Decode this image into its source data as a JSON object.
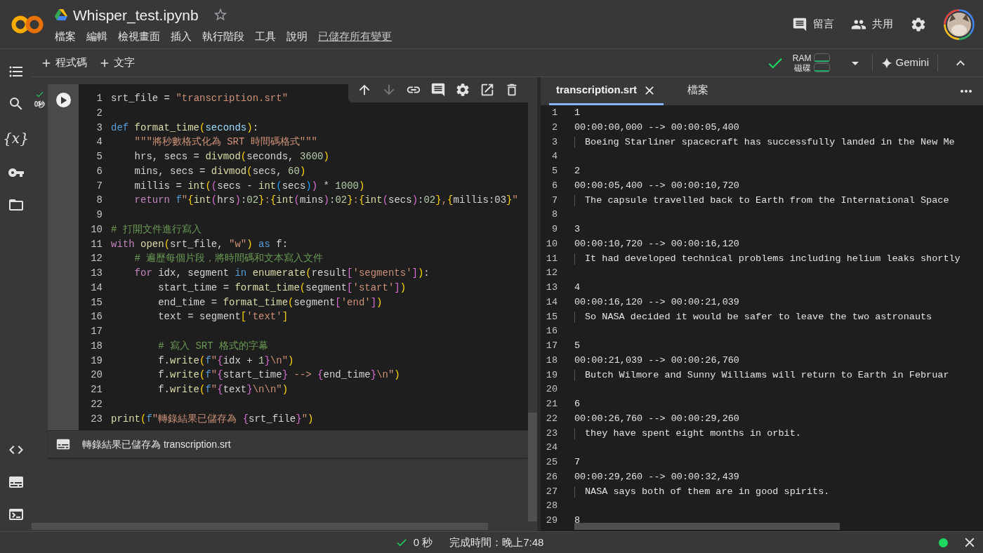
{
  "header": {
    "title": "Whisper_test.ipynb",
    "starred": false,
    "menu": [
      "檔案",
      "編輯",
      "檢視畫面",
      "插入",
      "執行階段",
      "工具",
      "說明"
    ],
    "save_status": "已儲存所有變更",
    "comment": "留言",
    "share": "共用"
  },
  "toolbar": {
    "add_code": "程式碼",
    "add_text": "文字",
    "connected": true,
    "ram_label": "RAM",
    "disk_label": "磁碟",
    "gemini": "Gemini"
  },
  "sidebar": {
    "variables_label": "{x}"
  },
  "cell": {
    "status": "0秒",
    "succeeded": true,
    "lines": [
      {
        "n": "1",
        "tokens": [
          {
            "kind": "plain",
            "t": "srt_file = "
          },
          {
            "kind": "str",
            "t": "\"transcription.srt\""
          }
        ]
      },
      {
        "n": "2"
      },
      {
        "n": "3",
        "tokens": [
          {
            "kind": "kw",
            "t": "def "
          },
          {
            "kind": "fn",
            "t": "format_time"
          },
          {
            "kind": "b1",
            "t": "("
          },
          {
            "kind": "var",
            "t": "seconds"
          },
          {
            "kind": "b1",
            "t": ")"
          },
          {
            "kind": "plain",
            "t": ":"
          }
        ]
      },
      {
        "n": "4",
        "tokens": [
          {
            "kind": "str",
            "t": "    \"\"\"將秒數格式化為 SRT 時間碼格式\"\"\""
          }
        ]
      },
      {
        "n": "5",
        "tokens": [
          {
            "kind": "plain",
            "t": "    hrs, secs = "
          },
          {
            "kind": "fn",
            "t": "divmod"
          },
          {
            "kind": "b1",
            "t": "("
          },
          {
            "kind": "plain",
            "t": "seconds, "
          },
          {
            "kind": "num",
            "t": "3600"
          },
          {
            "kind": "b1",
            "t": ")"
          }
        ]
      },
      {
        "n": "6",
        "tokens": [
          {
            "kind": "plain",
            "t": "    mins, secs = "
          },
          {
            "kind": "fn",
            "t": "divmod"
          },
          {
            "kind": "b1",
            "t": "("
          },
          {
            "kind": "plain",
            "t": "secs, "
          },
          {
            "kind": "num",
            "t": "60"
          },
          {
            "kind": "b1",
            "t": ")"
          }
        ]
      },
      {
        "n": "7",
        "tokens": [
          {
            "kind": "plain",
            "t": "    millis = "
          },
          {
            "kind": "fn",
            "t": "int"
          },
          {
            "kind": "b1",
            "t": "("
          },
          {
            "kind": "b2",
            "t": "("
          },
          {
            "kind": "plain",
            "t": "secs - "
          },
          {
            "kind": "fn",
            "t": "int"
          },
          {
            "kind": "b3",
            "t": "("
          },
          {
            "kind": "plain",
            "t": "secs"
          },
          {
            "kind": "b3",
            "t": ")"
          },
          {
            "kind": "b2",
            "t": ")"
          },
          {
            "kind": "plain",
            "t": " * "
          },
          {
            "kind": "num",
            "t": "1000"
          },
          {
            "kind": "b1",
            "t": ")"
          }
        ]
      },
      {
        "n": "8",
        "tokens": [
          {
            "kind": "kw2",
            "t": "    return "
          },
          {
            "kind": "kw",
            "t": "f"
          },
          {
            "kind": "str",
            "t": "\""
          },
          {
            "kind": "b1",
            "t": "{"
          },
          {
            "kind": "fn",
            "t": "int"
          },
          {
            "kind": "b2",
            "t": "("
          },
          {
            "kind": "plain",
            "t": "hrs"
          },
          {
            "kind": "b2",
            "t": ")"
          },
          {
            "kind": "plain",
            "t": ":"
          },
          {
            "kind": "num",
            "t": "02"
          },
          {
            "kind": "b1",
            "t": "}"
          },
          {
            "kind": "str",
            "t": ":"
          },
          {
            "kind": "b1",
            "t": "{"
          },
          {
            "kind": "fn",
            "t": "int"
          },
          {
            "kind": "b2",
            "t": "("
          },
          {
            "kind": "plain",
            "t": "mins"
          },
          {
            "kind": "b2",
            "t": ")"
          },
          {
            "kind": "plain",
            "t": ":"
          },
          {
            "kind": "num",
            "t": "02"
          },
          {
            "kind": "b1",
            "t": "}"
          },
          {
            "kind": "str",
            "t": ":"
          },
          {
            "kind": "b1",
            "t": "{"
          },
          {
            "kind": "fn",
            "t": "int"
          },
          {
            "kind": "b2",
            "t": "("
          },
          {
            "kind": "plain",
            "t": "secs"
          },
          {
            "kind": "b2",
            "t": ")"
          },
          {
            "kind": "plain",
            "t": ":"
          },
          {
            "kind": "num",
            "t": "02"
          },
          {
            "kind": "b1",
            "t": "}"
          },
          {
            "kind": "str",
            "t": ","
          },
          {
            "kind": "b1",
            "t": "{"
          },
          {
            "kind": "plain",
            "t": "millis:03"
          },
          {
            "kind": "b1",
            "t": "}"
          },
          {
            "kind": "str",
            "t": "\""
          }
        ]
      },
      {
        "n": "9"
      },
      {
        "n": "10",
        "tokens": [
          {
            "kind": "cmt",
            "t": "# 打開文件進行寫入"
          }
        ]
      },
      {
        "n": "11",
        "tokens": [
          {
            "kind": "kw2",
            "t": "with "
          },
          {
            "kind": "fn",
            "t": "open"
          },
          {
            "kind": "b1",
            "t": "("
          },
          {
            "kind": "plain",
            "t": "srt_file, "
          },
          {
            "kind": "str",
            "t": "\"w\""
          },
          {
            "kind": "b1",
            "t": ")"
          },
          {
            "kind": "kw",
            "t": " as "
          },
          {
            "kind": "plain",
            "t": "f:"
          }
        ]
      },
      {
        "n": "12",
        "tokens": [
          {
            "kind": "cmt",
            "t": "    # 遍歷每個片段，將時間碼和文本寫入文件"
          }
        ]
      },
      {
        "n": "13",
        "tokens": [
          {
            "kind": "kw2",
            "t": "    for "
          },
          {
            "kind": "plain",
            "t": "idx, segment "
          },
          {
            "kind": "kw",
            "t": "in "
          },
          {
            "kind": "fn",
            "t": "enumerate"
          },
          {
            "kind": "b1",
            "t": "("
          },
          {
            "kind": "plain",
            "t": "result"
          },
          {
            "kind": "b2",
            "t": "["
          },
          {
            "kind": "str",
            "t": "'segments'"
          },
          {
            "kind": "b2",
            "t": "]"
          },
          {
            "kind": "b1",
            "t": ")"
          },
          {
            "kind": "plain",
            "t": ":"
          }
        ]
      },
      {
        "n": "14",
        "tokens": [
          {
            "kind": "plain",
            "t": "        start_time = "
          },
          {
            "kind": "fn",
            "t": "format_time"
          },
          {
            "kind": "b1",
            "t": "("
          },
          {
            "kind": "plain",
            "t": "segment"
          },
          {
            "kind": "b2",
            "t": "["
          },
          {
            "kind": "str",
            "t": "'start'"
          },
          {
            "kind": "b2",
            "t": "]"
          },
          {
            "kind": "b1",
            "t": ")"
          }
        ]
      },
      {
        "n": "15",
        "tokens": [
          {
            "kind": "plain",
            "t": "        end_time = "
          },
          {
            "kind": "fn",
            "t": "format_time"
          },
          {
            "kind": "b1",
            "t": "("
          },
          {
            "kind": "plain",
            "t": "segment"
          },
          {
            "kind": "b2",
            "t": "["
          },
          {
            "kind": "str",
            "t": "'end'"
          },
          {
            "kind": "b2",
            "t": "]"
          },
          {
            "kind": "b1",
            "t": ")"
          }
        ]
      },
      {
        "n": "16",
        "tokens": [
          {
            "kind": "plain",
            "t": "        text = segment"
          },
          {
            "kind": "b1",
            "t": "["
          },
          {
            "kind": "str",
            "t": "'text'"
          },
          {
            "kind": "b1",
            "t": "]"
          }
        ]
      },
      {
        "n": "17"
      },
      {
        "n": "18",
        "tokens": [
          {
            "kind": "cmt",
            "t": "        # 寫入 SRT 格式的字幕"
          }
        ]
      },
      {
        "n": "19",
        "tokens": [
          {
            "kind": "plain",
            "t": "        f."
          },
          {
            "kind": "fn",
            "t": "write"
          },
          {
            "kind": "b1",
            "t": "("
          },
          {
            "kind": "kw",
            "t": "f"
          },
          {
            "kind": "str",
            "t": "\""
          },
          {
            "kind": "b2",
            "t": "{"
          },
          {
            "kind": "plain",
            "t": "idx + "
          },
          {
            "kind": "num",
            "t": "1"
          },
          {
            "kind": "b2",
            "t": "}"
          },
          {
            "kind": "str",
            "t": "\\n\""
          },
          {
            "kind": "b1",
            "t": ")"
          }
        ]
      },
      {
        "n": "20",
        "tokens": [
          {
            "kind": "plain",
            "t": "        f."
          },
          {
            "kind": "fn",
            "t": "write"
          },
          {
            "kind": "b1",
            "t": "("
          },
          {
            "kind": "kw",
            "t": "f"
          },
          {
            "kind": "str",
            "t": "\""
          },
          {
            "kind": "b2",
            "t": "{"
          },
          {
            "kind": "plain",
            "t": "start_time"
          },
          {
            "kind": "b2",
            "t": "}"
          },
          {
            "kind": "str",
            "t": " --> "
          },
          {
            "kind": "b2",
            "t": "{"
          },
          {
            "kind": "plain",
            "t": "end_time"
          },
          {
            "kind": "b2",
            "t": "}"
          },
          {
            "kind": "str",
            "t": "\\n\""
          },
          {
            "kind": "b1",
            "t": ")"
          }
        ]
      },
      {
        "n": "21",
        "tokens": [
          {
            "kind": "plain",
            "t": "        f."
          },
          {
            "kind": "fn",
            "t": "write"
          },
          {
            "kind": "b1",
            "t": "("
          },
          {
            "kind": "kw",
            "t": "f"
          },
          {
            "kind": "str",
            "t": "\""
          },
          {
            "kind": "b2",
            "t": "{"
          },
          {
            "kind": "plain",
            "t": "text"
          },
          {
            "kind": "b2",
            "t": "}"
          },
          {
            "kind": "str",
            "t": "\\n\\n\""
          },
          {
            "kind": "b1",
            "t": ")"
          }
        ]
      },
      {
        "n": "22"
      },
      {
        "n": "23",
        "tokens": [
          {
            "kind": "fn",
            "t": "print"
          },
          {
            "kind": "b1",
            "t": "("
          },
          {
            "kind": "kw",
            "t": "f"
          },
          {
            "kind": "str",
            "t": "\"轉錄結果已儲存為 "
          },
          {
            "kind": "b2",
            "t": "{"
          },
          {
            "kind": "plain",
            "t": "srt_file"
          },
          {
            "kind": "b2",
            "t": "}"
          },
          {
            "kind": "str",
            "t": "\""
          },
          {
            "kind": "b1",
            "t": ")"
          }
        ]
      }
    ],
    "output": "轉錄結果已儲存為 transcription.srt"
  },
  "file_panel": {
    "tabs": [
      {
        "label": "transcription.srt",
        "selected": true,
        "closable": true
      },
      {
        "label": "檔案",
        "selected": false,
        "closable": false
      }
    ],
    "lines": [
      {
        "n": "1",
        "kind": "index",
        "text": "1"
      },
      {
        "n": "2",
        "kind": "time",
        "text": "00:00:00,000 --> 00:00:05,400"
      },
      {
        "n": "3",
        "kind": "text",
        "text": "Boeing Starliner spacecraft has successfully landed in the New Me"
      },
      {
        "n": "4",
        "kind": "blank"
      },
      {
        "n": "5",
        "kind": "index",
        "text": "2"
      },
      {
        "n": "6",
        "kind": "time",
        "text": "00:00:05,400 --> 00:00:10,720"
      },
      {
        "n": "7",
        "kind": "text",
        "text": "The capsule travelled back to Earth from the International Space"
      },
      {
        "n": "8",
        "kind": "blank"
      },
      {
        "n": "9",
        "kind": "index",
        "text": "3"
      },
      {
        "n": "10",
        "kind": "time",
        "text": "00:00:10,720 --> 00:00:16,120"
      },
      {
        "n": "11",
        "kind": "text",
        "text": "It had developed technical problems including helium leaks shortly"
      },
      {
        "n": "12",
        "kind": "blank"
      },
      {
        "n": "13",
        "kind": "index",
        "text": "4"
      },
      {
        "n": "14",
        "kind": "time",
        "text": "00:00:16,120 --> 00:00:21,039"
      },
      {
        "n": "15",
        "kind": "text",
        "text": "So NASA decided it would be safer to leave the two astronauts"
      },
      {
        "n": "16",
        "kind": "blank"
      },
      {
        "n": "17",
        "kind": "index",
        "text": "5"
      },
      {
        "n": "18",
        "kind": "time",
        "text": "00:00:21,039 --> 00:00:26,760"
      },
      {
        "n": "19",
        "kind": "text",
        "text": "Butch Wilmore and Sunny Williams will return to Earth in Februar"
      },
      {
        "n": "20",
        "kind": "blank"
      },
      {
        "n": "21",
        "kind": "index",
        "text": "6"
      },
      {
        "n": "22",
        "kind": "time",
        "text": "00:00:26,760 --> 00:00:29,260"
      },
      {
        "n": "23",
        "kind": "text",
        "text": "they have spent eight months in orbit."
      },
      {
        "n": "24",
        "kind": "blank"
      },
      {
        "n": "25",
        "kind": "index",
        "text": "7"
      },
      {
        "n": "26",
        "kind": "time",
        "text": "00:00:29,260 --> 00:00:32,439"
      },
      {
        "n": "27",
        "kind": "text",
        "text": "NASA says both of them are in good spirits."
      },
      {
        "n": "28",
        "kind": "blank"
      },
      {
        "n": "29",
        "kind": "index",
        "text": "8"
      }
    ]
  },
  "status_bar": {
    "duration": "0 秒",
    "succeeded": true,
    "finished": "完成時間：晚上7:48",
    "connected": true
  }
}
